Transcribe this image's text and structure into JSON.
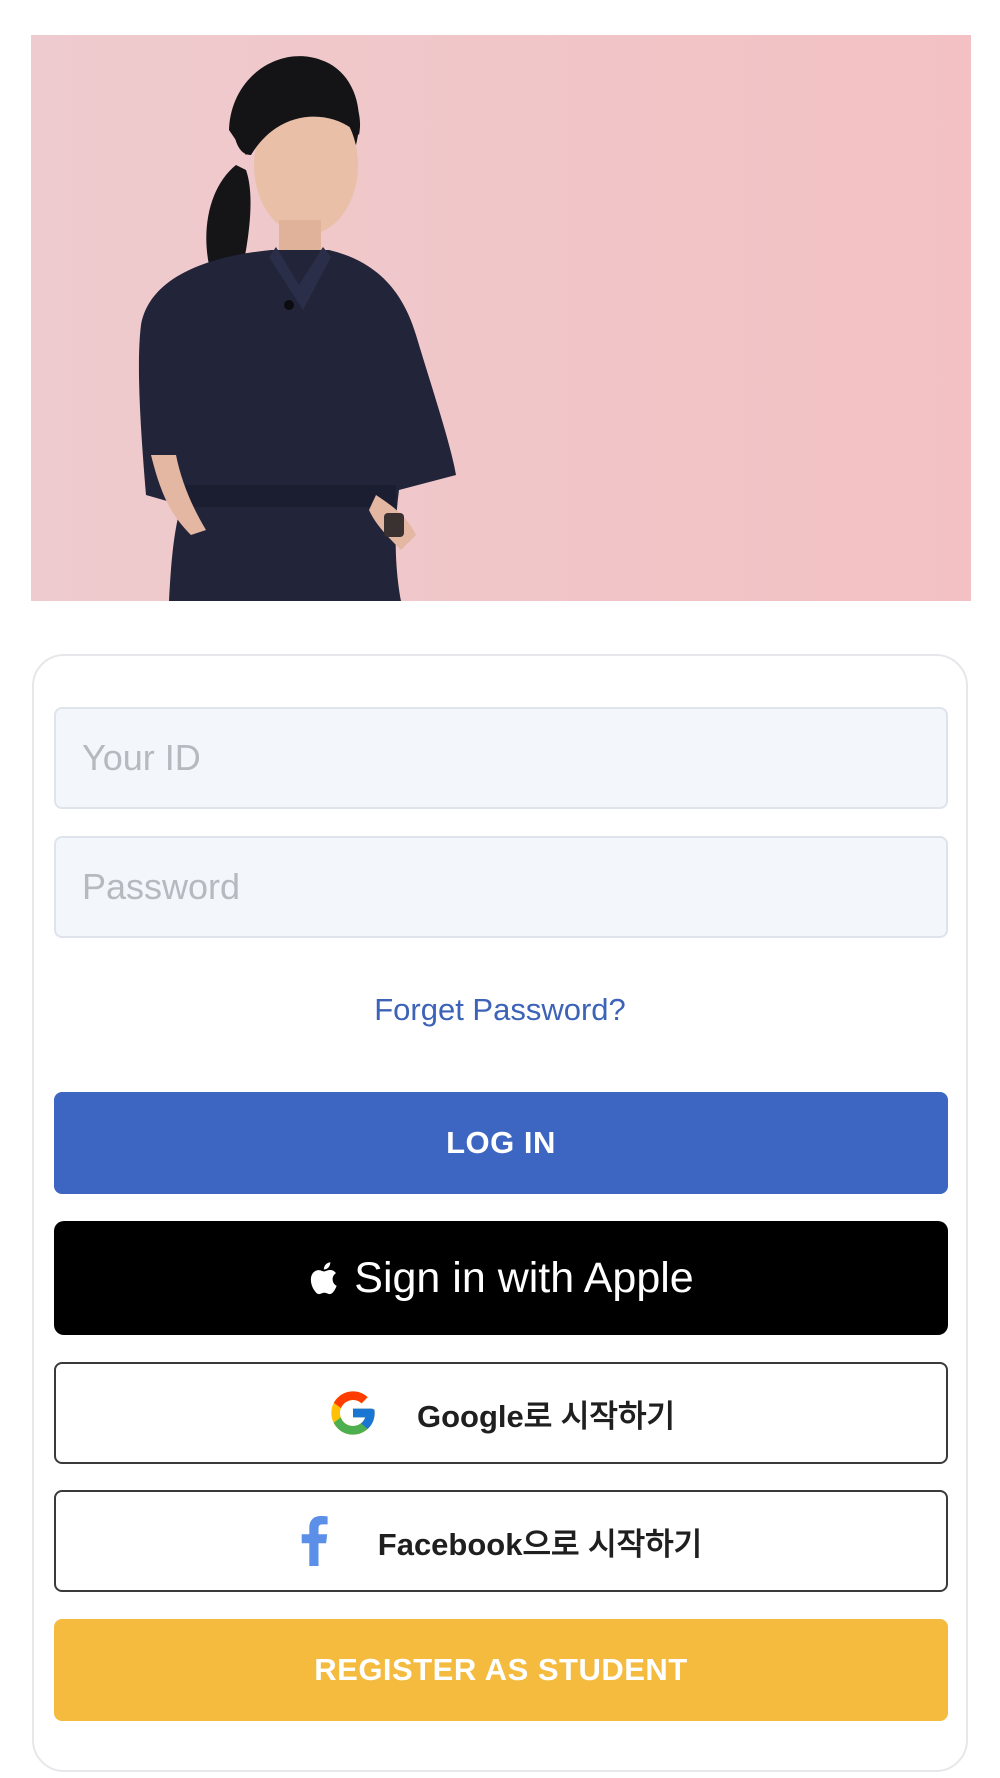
{
  "login_form": {
    "id_placeholder": "Your ID",
    "password_placeholder": "Password",
    "forgot_password": "Forget Password?",
    "login_label": "LOG IN",
    "apple_label": "Sign in with Apple",
    "google_label": "Google로 시작하기",
    "facebook_label": "Facebook으로 시작하기",
    "register_label": "REGISTER AS STUDENT"
  },
  "icons": {
    "apple": "apple-icon",
    "google": "google-icon",
    "facebook": "facebook-icon"
  },
  "colors": {
    "login_button": "#3d66c2",
    "apple_button": "#000000",
    "register_button": "#f4bb3f",
    "link": "#3c63b8",
    "hero_background": "#f0c6c8"
  }
}
